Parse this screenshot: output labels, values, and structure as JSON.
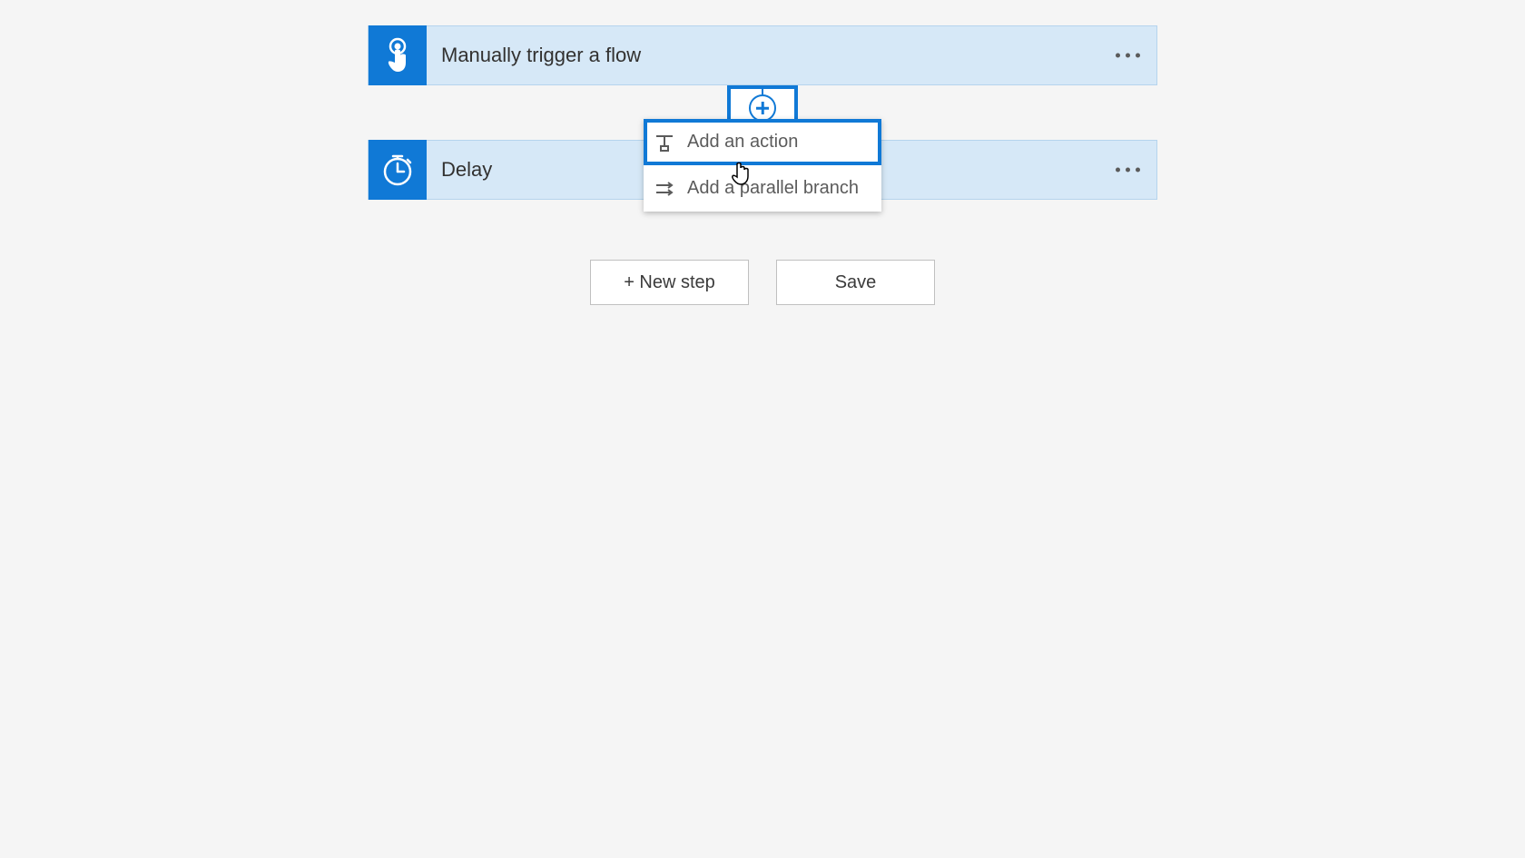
{
  "steps": [
    {
      "label": "Manually trigger a flow",
      "icon": "touch-icon"
    },
    {
      "label": "Delay",
      "icon": "timer-icon"
    }
  ],
  "insert_menu": {
    "items": [
      {
        "label": "Add an action",
        "highlighted": true
      },
      {
        "label": "Add a parallel branch",
        "highlighted": false
      }
    ]
  },
  "footer": {
    "new_step_label": "+ New step",
    "save_label": "Save"
  }
}
